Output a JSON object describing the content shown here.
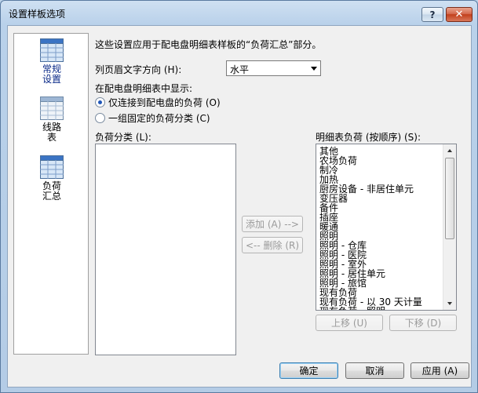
{
  "window": {
    "title": "设置样板选项",
    "help_label": "?",
    "close_label": "✕"
  },
  "sidebar": {
    "items": [
      {
        "line1": "常规",
        "line2": "设置",
        "icon": "grid-icon",
        "active": true
      },
      {
        "line1": "线路",
        "line2": "表",
        "icon": "grid-icon",
        "active": false
      },
      {
        "line1": "负荷",
        "line2": "汇总",
        "icon": "grid-icon",
        "active": false
      }
    ]
  },
  "main": {
    "description": "这些设置应用于配电盘明细表样板的“负荷汇总”部分。",
    "header_dir_label": "列页眉文字方向 (H):",
    "header_dir_value": "水平",
    "show_label": "在配电盘明细表中显示:",
    "radio1_label": "仅连接到配电盘的负荷 (O)",
    "radio2_label": "一组固定的负荷分类 (C)",
    "left_list_label": "负荷分类 (L):",
    "right_list_label": "明细表负荷 (按顺序) (S):",
    "right_list_items": [
      "其他",
      "农场负荷",
      "制冷",
      "加热",
      "厨房设备 - 非居住单元",
      "变压器",
      "备件",
      "插座",
      "暖通",
      "照明",
      "照明 - 仓库",
      "照明 - 医院",
      "照明 - 室外",
      "照明 - 居住单元",
      "照明 - 旅馆",
      "现有负荷",
      "现有负荷 - 以 30 天计量",
      "现有负荷 - 照明"
    ],
    "add_button": "添加 (A) -->",
    "remove_button": "<-- 删除 (R)",
    "move_up_button": "上移 (U)",
    "move_down_button": "下移 (D)"
  },
  "footer": {
    "ok_button": "确定",
    "cancel_button": "取消",
    "apply_button": "应用 (A)"
  },
  "colors": {
    "accent_radio": "#1f56b8",
    "active_nav_text": "#0a2a88",
    "icon_header": "#3b74c4",
    "icon_cell": "#d8e7f7"
  }
}
